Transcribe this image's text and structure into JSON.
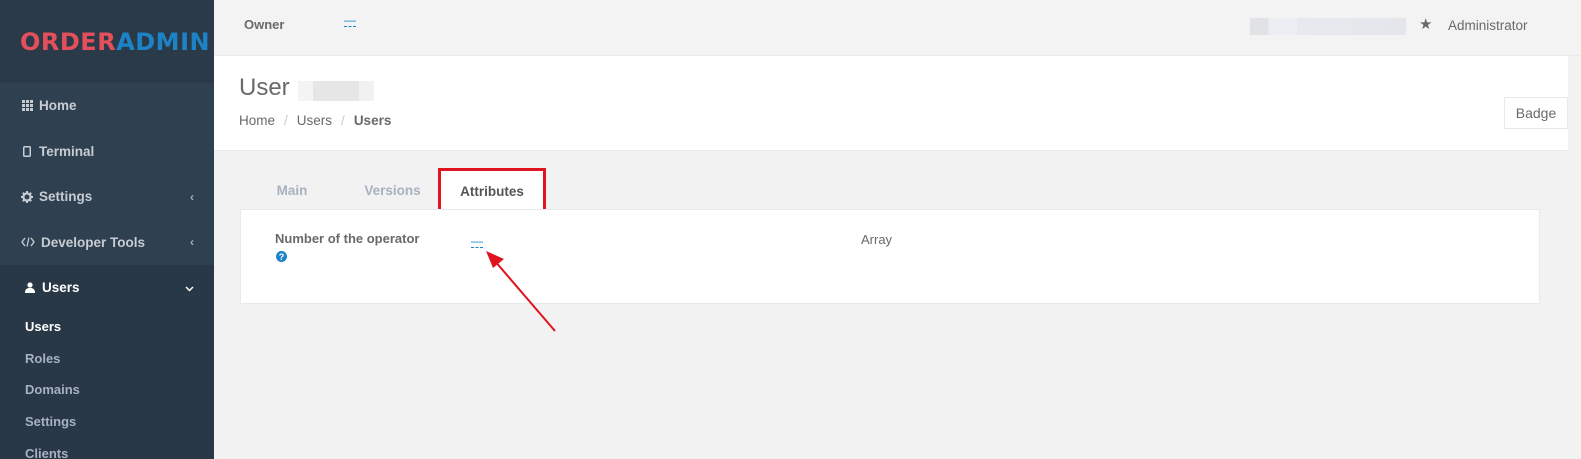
{
  "sidebar": {
    "logo": {
      "part1": "ORDER",
      "part2": "ADMIN"
    },
    "items": [
      {
        "label": "Home",
        "icon": "grid-icon"
      },
      {
        "label": "Terminal",
        "icon": "tablet-icon"
      },
      {
        "label": "Settings",
        "icon": "gear-icon",
        "chevron": "‹"
      },
      {
        "label": "Developer Tools",
        "icon": "code-icon",
        "chevron": "‹"
      },
      {
        "label": "Users",
        "icon": "user-icon",
        "chevron": "⌄"
      }
    ],
    "subitems": [
      "Users",
      "Roles",
      "Domains",
      "Settings",
      "Clients"
    ]
  },
  "topbar": {
    "owner_label": "Owner",
    "owner_value": "—",
    "user_role": "Administrator"
  },
  "heading": {
    "title": "User",
    "breadcrumb": [
      "Home",
      "Users",
      "Users"
    ],
    "badge_button": "Badge"
  },
  "tabs": [
    "Main",
    "Versions",
    "Attributes"
  ],
  "panel": {
    "field_label": "Number of the operator",
    "field_value": "—",
    "type_label": "Array"
  },
  "colors": {
    "accent": "#1c84c6",
    "brand_red": "#e3505b",
    "highlight": "#e0141e",
    "sidebar": "#2f4050"
  }
}
